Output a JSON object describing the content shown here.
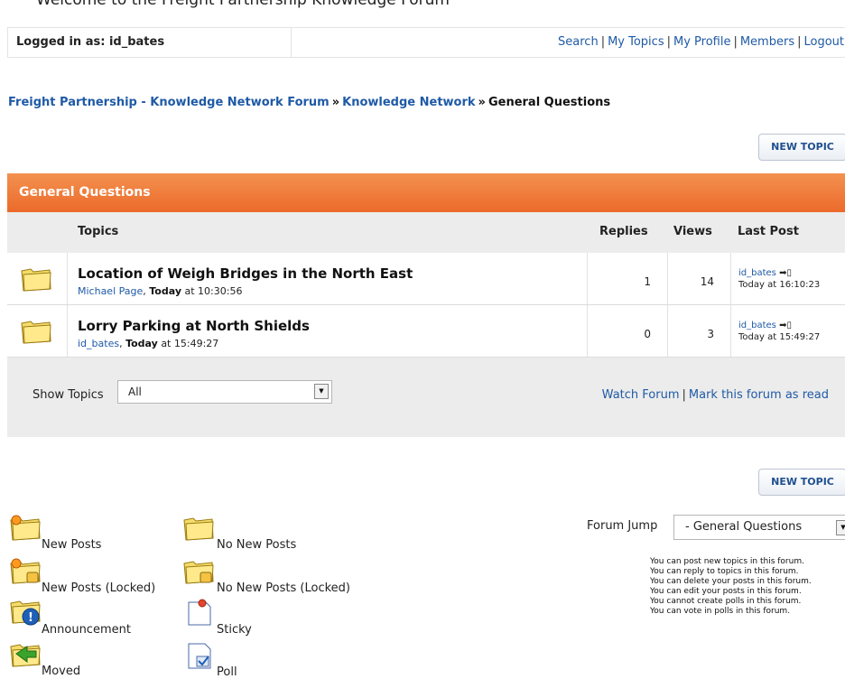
{
  "top_clip": "Welcome to the Freight Partnership Knowledge Forum",
  "userbar": {
    "logged_in": "Logged in as: id_bates",
    "links": [
      "Search",
      "My Topics",
      "My Profile",
      "Members",
      "Logout"
    ]
  },
  "breadcrumb": {
    "items": [
      "Freight Partnership - Knowledge Network Forum",
      "Knowledge Network"
    ],
    "separator": "»",
    "current": "General Questions"
  },
  "new_topic_label": "NEW TOPIC",
  "forum": {
    "title": "General Questions",
    "columns": {
      "topics": "Topics",
      "replies": "Replies",
      "views": "Views",
      "last_post": "Last Post"
    },
    "topics": [
      {
        "title": "Location of Weigh Bridges in the North East",
        "author": "Michael Page",
        "day": "Today",
        "at": "at 10:30:56",
        "replies": "1",
        "views": "14",
        "last_user": "id_bates",
        "last_time": "Today at 16:10:23"
      },
      {
        "title": "Lorry Parking at North Shields",
        "author": "id_bates",
        "day": "Today",
        "at": "at 15:49:27",
        "replies": "0",
        "views": "3",
        "last_user": "id_bates",
        "last_time": "Today at 15:49:27"
      }
    ],
    "show_topics_label": "Show Topics",
    "show_topics_value": "All",
    "watch_forum": "Watch Forum",
    "mark_read": "Mark this forum as read"
  },
  "legend": {
    "new_posts": "New Posts",
    "no_new_posts": "No New Posts",
    "new_posts_locked": "New Posts (Locked)",
    "no_new_posts_locked": "No New Posts (Locked)",
    "announcement": "Announcement",
    "sticky": "Sticky",
    "moved": "Moved",
    "poll": "Poll"
  },
  "forum_jump": {
    "label": "Forum Jump",
    "value": "- General Questions"
  },
  "permissions": [
    "You can post new topics in this forum.",
    "You can reply to topics in this forum.",
    "You can delete your posts in this forum.",
    "You can edit your posts in this forum.",
    "You cannot create polls in this forum.",
    "You can vote in polls in this forum."
  ]
}
